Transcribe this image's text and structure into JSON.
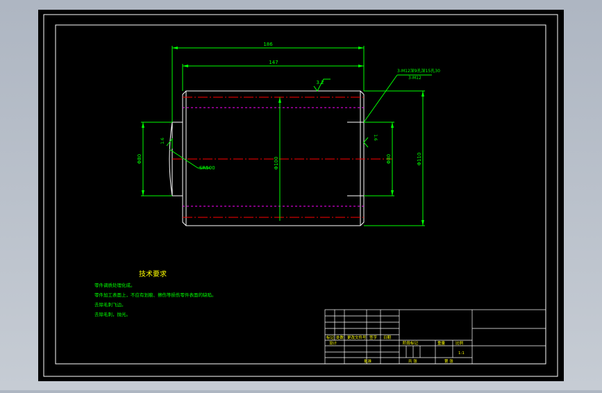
{
  "drawing": {
    "dimensions": {
      "overall_length": "186",
      "body_length": "147",
      "roughness": "3.2",
      "thread_note_1": "3-M12深9孔深15孔30",
      "thread_note_2": "3-M12",
      "left_diameter": "Φ80",
      "outer_diameter": "Φ100",
      "right_diameter": "Φ80",
      "right_outer_diameter": "Φ110",
      "left_chamfer": "1.6",
      "right_chamfer": "1.6",
      "sphere_note": "SR500"
    },
    "technical_requirements": {
      "title": "技术要求",
      "items": [
        "零件调质处理化成。",
        "零件加工表面上，不应有划痕、擦伤等损伤零件表面的缺陷。",
        "去除毛刺飞边。",
        "去除毛刺，抛光。"
      ]
    },
    "title_block": {
      "label_mark": "标记",
      "label_count": "处数",
      "label_change_doc": "更改文件号",
      "label_sign": "签字",
      "label_date": "日期",
      "label_designer": "设计",
      "label_stage_mark": "阶段标记",
      "label_weight": "重量",
      "label_scale": "比例",
      "scale_value": "1:1",
      "label_approve": "批准",
      "label_total": "共 张",
      "label_sheet": "第 张"
    }
  },
  "colors": {
    "background": "#000000",
    "frame": "#ffffff",
    "part": "#ffffff",
    "dimension": "#00ff00",
    "centerline": "#ff0000",
    "hidden": "#ff00ff",
    "text": "#00ff00",
    "title_text": "#ffff00"
  }
}
